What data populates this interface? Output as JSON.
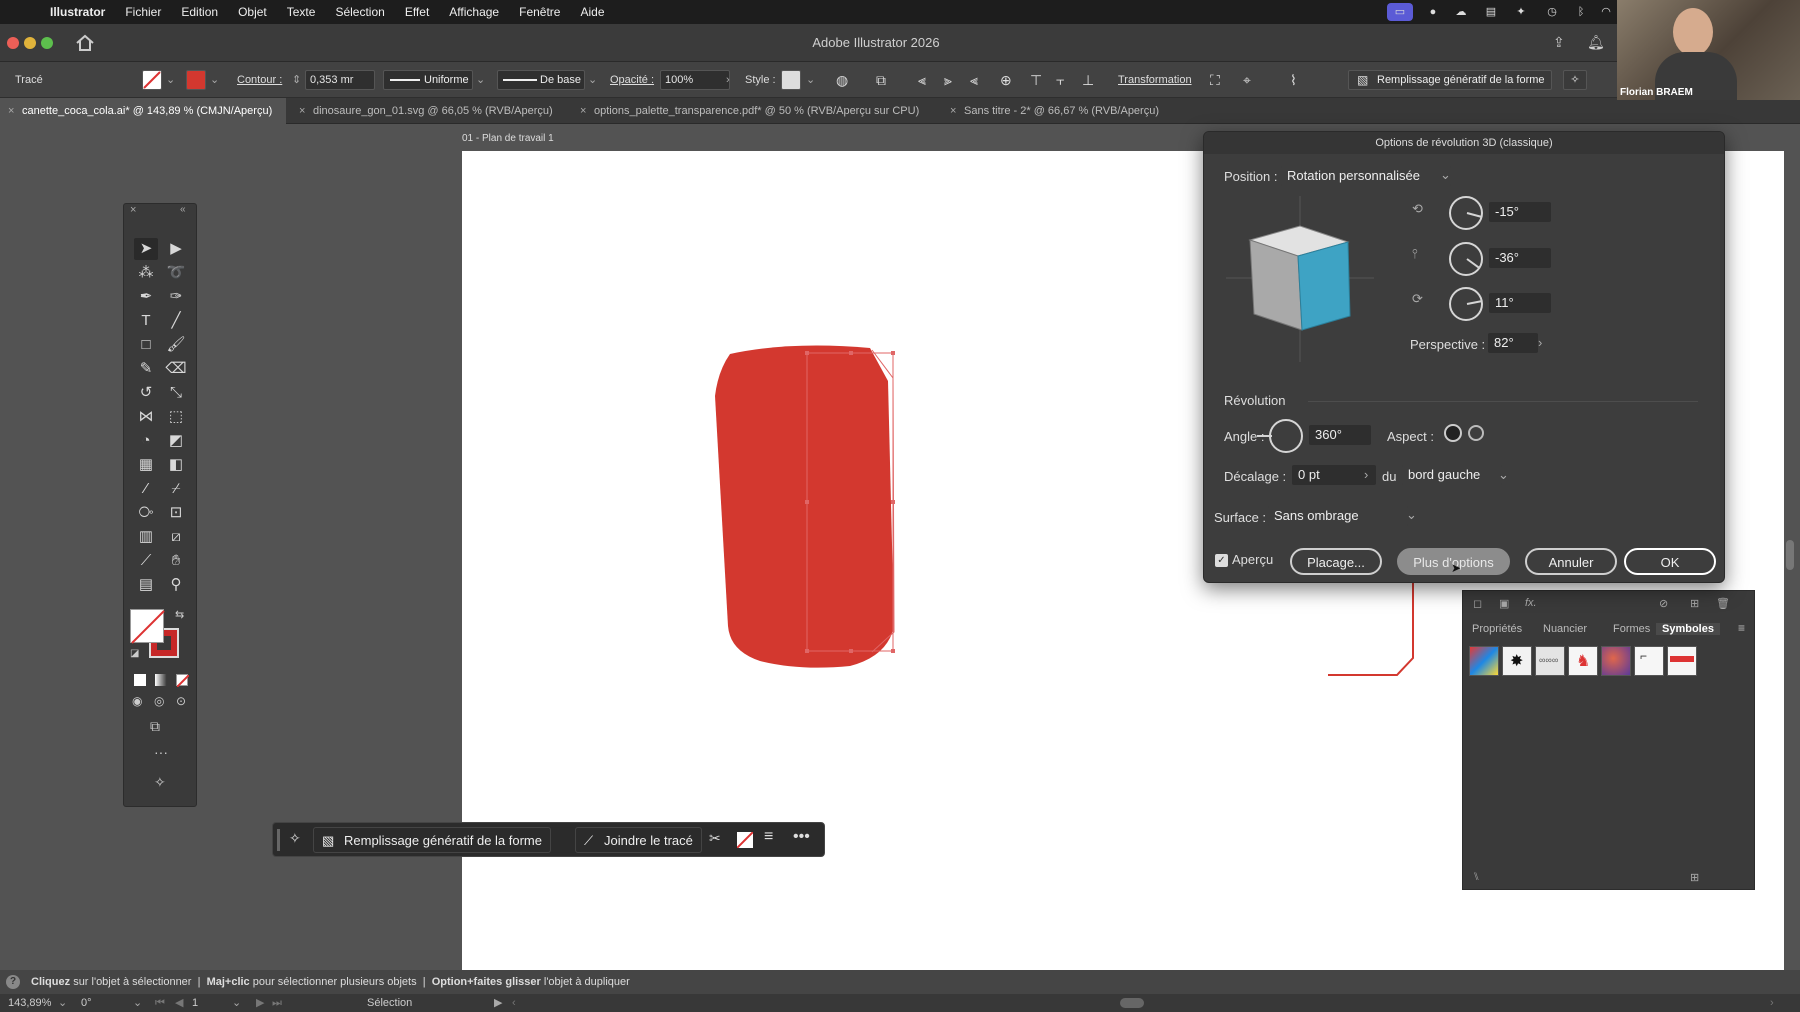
{
  "menubar": {
    "app": "Illustrator",
    "items": [
      "Fichier",
      "Edition",
      "Objet",
      "Texte",
      "Sélection",
      "Effet",
      "Affichage",
      "Fenêtre",
      "Aide"
    ]
  },
  "window": {
    "title": "Adobe Illustrator 2026"
  },
  "control_bar": {
    "object_type": "Tracé",
    "stroke_label": "Contour :",
    "stroke_weight": "0,353 mr",
    "profile": "Uniforme",
    "brush": "De base",
    "opacity_label": "Opacité :",
    "opacity": "100%",
    "style_label": "Style :",
    "transform_label": "Transformation",
    "gen_fill_label": "Remplissage génératif de la forme"
  },
  "tabs": [
    {
      "label": "canette_coca_cola.ai* @ 143,89 % (CMJN/Aperçu)",
      "active": true
    },
    {
      "label": "dinosaure_gon_01.svg @ 66,05 % (RVB/Aperçu)",
      "active": false
    },
    {
      "label": "options_palette_transparence.pdf* @ 50 % (RVB/Aperçu sur CPU)",
      "active": false
    },
    {
      "label": "Sans titre - 2* @ 66,67 % (RVB/Aperçu)",
      "active": false
    }
  ],
  "artboard": {
    "title": "01 - Plan de travail 1"
  },
  "colors": {
    "can": "#d3382f",
    "cube_front": "#3ea3c4",
    "cube_side": "#a9a9a9",
    "cube_top": "#e2e2e2",
    "selection": "#e06666"
  },
  "context_bar": {
    "gen_fill": "Remplissage génératif de la forme",
    "join_path": "Joindre le tracé"
  },
  "dialog": {
    "title": "Options de révolution 3D (classique)",
    "position_label": "Position :",
    "position_value": "Rotation personnalisée",
    "rot_x": "-15°",
    "rot_y": "-36°",
    "rot_z": "11°",
    "perspective_label": "Perspective :",
    "perspective_value": "82°",
    "revolution_label": "Révolution",
    "angle_label": "Angle :",
    "angle_value": "360°",
    "aspect_label": "Aspect :",
    "offset_label": "Décalage :",
    "offset_value": "0 pt",
    "from_label": "du",
    "from_value": "bord gauche",
    "surface_label": "Surface :",
    "surface_value": "Sans ombrage",
    "preview_label": "Aperçu",
    "preview_checked": true,
    "btn_map": "Placage...",
    "btn_more": "Plus d'options",
    "btn_cancel": "Annuler",
    "btn_ok": "OK"
  },
  "panel": {
    "tabs": [
      "Propriétés",
      "Nuancier",
      "Formes",
      "Symboles"
    ],
    "active_tab": "Symboles"
  },
  "hint": {
    "a_bold": "Cliquez",
    "a_text": "sur l'objet à sélectionner",
    "b_bold": "Maj+clic",
    "b_text": "pour sélectionner plusieurs objets",
    "c_bold": "Option+faites glisser",
    "c_text": "l'objet à dupliquer"
  },
  "status": {
    "zoom": "143,89%",
    "rotation": "0°",
    "artboard_num": "1",
    "mode": "Sélection"
  },
  "webcam": {
    "name": "Florian BRAEM"
  }
}
